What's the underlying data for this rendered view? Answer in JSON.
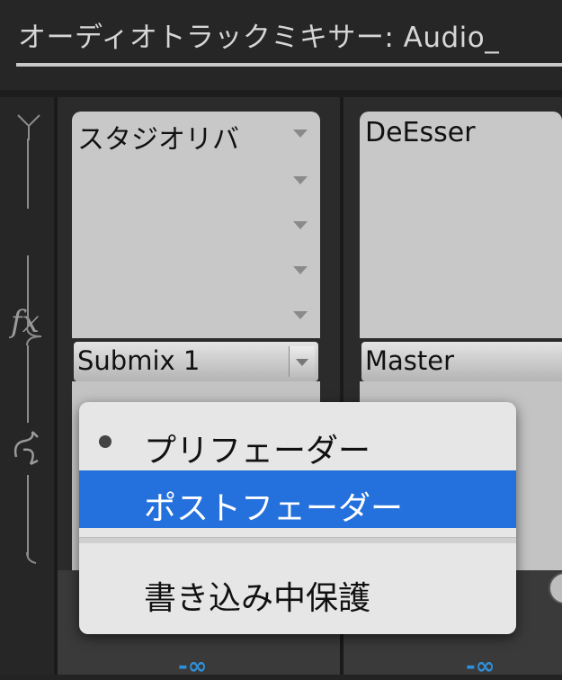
{
  "window": {
    "title": "オーディオトラックミキサー: Audio_"
  },
  "rail": {
    "fx_label": "fx",
    "send_icon": "send-route-icon"
  },
  "strips": [
    {
      "effect_name": "スタジオリバ",
      "send_target": "Submix 1",
      "volume_readout": "-∞"
    },
    {
      "effect_name": "DeEsser",
      "send_target": "Master",
      "volume_readout": "-∞"
    }
  ],
  "context_menu": {
    "items": [
      {
        "label": "プリフェーダー",
        "checked": true,
        "selected": false
      },
      {
        "label": "ポストフェーダー",
        "checked": false,
        "selected": true
      },
      {
        "label": "書き込み中保護",
        "checked": false,
        "selected": false
      }
    ]
  },
  "colors": {
    "selection": "#2470dc",
    "infinity_readout": "#2f8fd8"
  }
}
